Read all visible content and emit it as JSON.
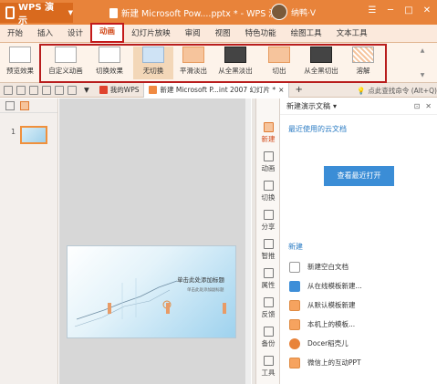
{
  "titlebar": {
    "app_name": "WPS 演示",
    "doc_title": "新建 Microsoft Pow....pptx * - WPS 演示",
    "user_name": "纳鸭·V"
  },
  "menu": {
    "tabs": [
      "开始",
      "插入",
      "设计",
      "动画",
      "幻灯片放映",
      "审阅",
      "视图",
      "特色功能",
      "绘图工具",
      "文本工具"
    ],
    "active": "动画"
  },
  "ribbon": {
    "items": [
      {
        "label": "预览效果"
      },
      {
        "label": "自定义动画"
      },
      {
        "label": "切换效果"
      },
      {
        "label": "无切换"
      },
      {
        "label": "平滑淡出"
      },
      {
        "label": "从全黑淡出"
      },
      {
        "label": "切出"
      },
      {
        "label": "从全黑切出"
      },
      {
        "label": "溶解"
      }
    ]
  },
  "tabbar": {
    "my_wps": "我的WPS",
    "doc_tab": "新建 Microsoft P...int 2007 幻灯片 *",
    "search_cmd": "点此查找命令 (Alt+Q)"
  },
  "slides": {
    "thumb_number": "1",
    "title_placeholder": "单击此处添加标题",
    "subtitle_placeholder": "单击此处添加副标题"
  },
  "sidebar": {
    "items": [
      "新建",
      "动画",
      "切换",
      "分享",
      "智推",
      "属性",
      "反馈",
      "备份",
      "工具"
    ]
  },
  "taskpane": {
    "title": "新建演示文稿",
    "recent_label": "最近使用的云文档",
    "view_recent_button": "查看最近打开",
    "new_label": "新建",
    "new_items": [
      {
        "label": "新建空白文档"
      },
      {
        "label": "从在线模板新建..."
      },
      {
        "label": "从默认模板新建"
      },
      {
        "label": "本机上的模板..."
      },
      {
        "label": "Docer稻壳儿"
      },
      {
        "label": "微信上的互动PPT"
      }
    ]
  }
}
